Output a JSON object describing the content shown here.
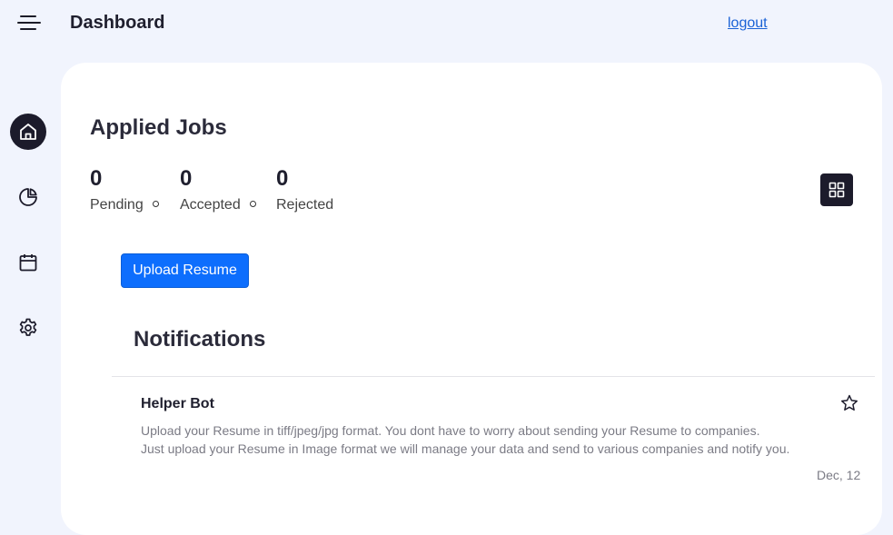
{
  "header": {
    "title": "Dashboard",
    "logout_label": "logout"
  },
  "sidebar": {
    "items": [
      {
        "icon": "home-icon",
        "active": true
      },
      {
        "icon": "pie-chart-icon",
        "active": false
      },
      {
        "icon": "calendar-icon",
        "active": false
      },
      {
        "icon": "gear-icon",
        "active": false
      }
    ]
  },
  "applied_jobs": {
    "title": "Applied Jobs",
    "stats": [
      {
        "value": "0",
        "label": "Pending"
      },
      {
        "value": "0",
        "label": "Accepted"
      },
      {
        "value": "0",
        "label": "Rejected"
      }
    ],
    "view_toggle_icon": "grid-icon"
  },
  "upload_label": "Upload Resume",
  "notifications": {
    "title": "Notifications",
    "items": [
      {
        "sender": "Helper Bot",
        "line1": "Upload your Resume in tiff/jpeg/jpg format. You dont have to worry about sending your Resume to companies.",
        "line2": "Just upload your Resume in Image format we will manage your data and send to various companies and notify you.",
        "date": "Dec, 12",
        "icon": "star-icon"
      }
    ]
  },
  "colors": {
    "background": "#f1f4fd",
    "dark": "#1c1b2b",
    "primary": "#0d6efd",
    "link": "#1a62d6"
  }
}
